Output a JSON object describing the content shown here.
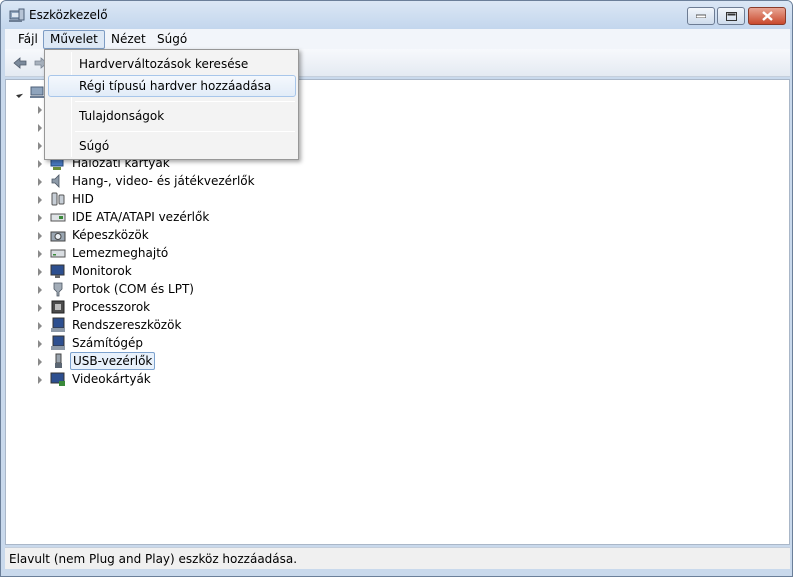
{
  "window": {
    "title": "Eszközkezelő"
  },
  "menubar": [
    {
      "label": "Fájl"
    },
    {
      "label": "Művelet"
    },
    {
      "label": "Nézet"
    },
    {
      "label": "Súgó"
    }
  ],
  "dropdown": {
    "items": [
      {
        "label": "Hardverváltozások keresése"
      },
      {
        "label": "Régi típusú hardver hozzáadása"
      },
      {
        "label": "Tulajdonságok"
      },
      {
        "label": "Súgó"
      }
    ]
  },
  "tree": {
    "items": [
      {
        "label": "Hálózati kártyák",
        "icon": "network-adapter-icon"
      },
      {
        "label": "Hang-, video- és játékvezérlők",
        "icon": "speaker-icon"
      },
      {
        "label": "HID",
        "icon": "hid-icon"
      },
      {
        "label": "IDE ATA/ATAPI vezérlők",
        "icon": "ide-controller-icon"
      },
      {
        "label": "Képeszközök",
        "icon": "camera-icon"
      },
      {
        "label": "Lemezmeghajtó",
        "icon": "disk-drive-icon"
      },
      {
        "label": "Monitorok",
        "icon": "monitor-icon"
      },
      {
        "label": "Portok (COM és LPT)",
        "icon": "port-icon"
      },
      {
        "label": "Processzorok",
        "icon": "processor-icon"
      },
      {
        "label": "Rendszereszközök",
        "icon": "system-devices-icon"
      },
      {
        "label": "Számítógép",
        "icon": "computer-icon"
      },
      {
        "label": "USB-vezérlők",
        "icon": "usb-icon"
      },
      {
        "label": "Videokártyák",
        "icon": "video-card-icon"
      }
    ]
  },
  "status": {
    "text": "Elavult (nem Plug and Play) eszköz hozzáadása."
  },
  "colors": {
    "selection_border": "#7da2ce",
    "menu_hover": "#a8c6ea",
    "window_frame": "#c9d9ec"
  }
}
